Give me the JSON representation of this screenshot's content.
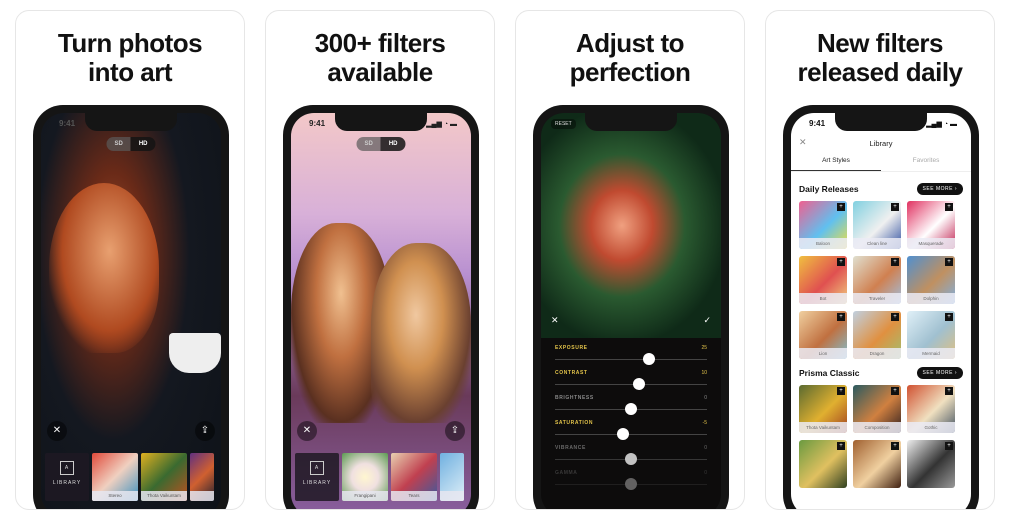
{
  "panels": [
    {
      "headline_1": "Turn photos",
      "headline_2": "into art",
      "time": "9:41",
      "sd": "SD",
      "hd": "HD",
      "library": "LIBRARY",
      "library_icon_letter": "A",
      "thumbs": [
        "Stereo",
        "Thota Vaikuntam",
        ""
      ]
    },
    {
      "headline_1": "300+ filters",
      "headline_2": "available",
      "time": "9:41",
      "sd": "SD",
      "hd": "HD",
      "library": "LIBRARY",
      "library_icon_letter": "A",
      "thumbs": [
        "Frangipani",
        "Tears",
        ""
      ]
    },
    {
      "headline_1": "Adjust to",
      "headline_2": "perfection",
      "reset": "RESET",
      "sliders": [
        {
          "label": "EXPOSURE",
          "value": "25",
          "level": 0.62,
          "active": true
        },
        {
          "label": "CONTRAST",
          "value": "10",
          "level": 0.55,
          "active": true
        },
        {
          "label": "BRIGHTNESS",
          "value": "0",
          "level": 0.5,
          "active": false
        },
        {
          "label": "SATURATION",
          "value": "-5",
          "level": 0.45,
          "active": true
        },
        {
          "label": "VIBRANCE",
          "value": "0",
          "level": 0.5,
          "active": false
        },
        {
          "label": "GAMMA",
          "value": "0",
          "level": 0.5,
          "active": false
        }
      ]
    },
    {
      "headline_1": "New filters",
      "headline_2": "released daily",
      "time": "9:41",
      "title": "Library",
      "tabs": [
        "Art Styles",
        "Favorites"
      ],
      "sections": [
        {
          "title": "Daily Releases",
          "more": "SEE MORE ›",
          "items": [
            "Baloon",
            "Clean line",
            "Masquerade",
            "Bot",
            "Traveler",
            "Dolphin",
            "Lion",
            "Dragon",
            "Mermaid"
          ]
        },
        {
          "title": "Prisma Classic",
          "more": "SEE MORE ›",
          "items": [
            "Thota Vaikuntam",
            "Composition",
            "Gothic",
            "",
            "",
            ""
          ]
        }
      ]
    }
  ],
  "colors": {
    "accent_yellow": "#e2c34a",
    "phone_frame": "#151515"
  }
}
